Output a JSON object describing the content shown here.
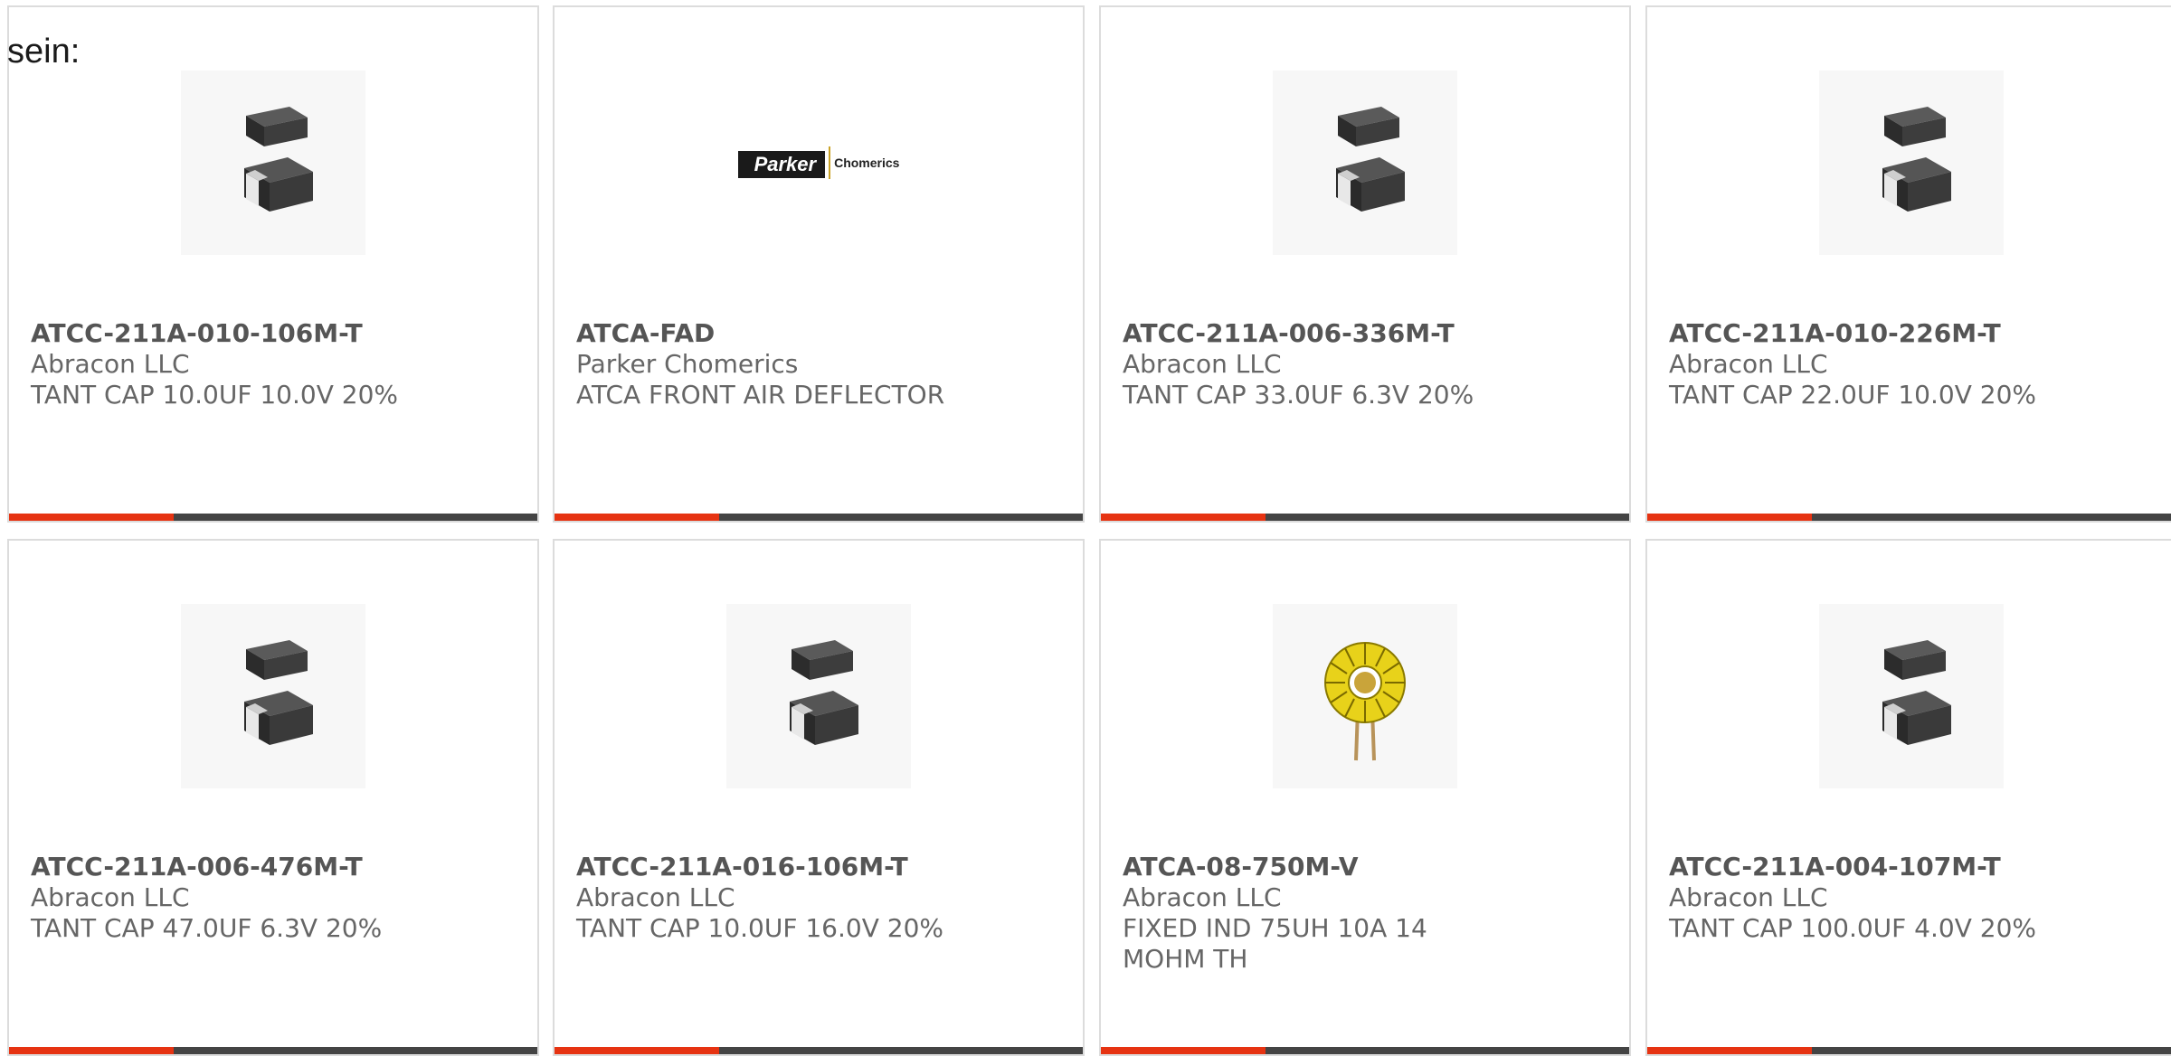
{
  "intro_text": "sein:",
  "accent_color": "#e63312",
  "products": [
    {
      "part": "ATCC-211A-010-106M-T",
      "manufacturer": "Abracon LLC",
      "description": "TANT CAP 10.0UF 10.0V 20%",
      "image": "tantalum-capacitor-icon"
    },
    {
      "part": "ATCA-FAD",
      "manufacturer": "Parker Chomerics",
      "description": "ATCA FRONT AIR DEFLECTOR",
      "image": "parker-chomerics-logo",
      "logo_word": "Parker",
      "logo_sub": "Chomerics"
    },
    {
      "part": "ATCC-211A-006-336M-T",
      "manufacturer": "Abracon LLC",
      "description": "TANT CAP 33.0UF 6.3V 20%",
      "image": "tantalum-capacitor-icon"
    },
    {
      "part": "ATCC-211A-010-226M-T",
      "manufacturer": "Abracon LLC",
      "description": "TANT CAP 22.0UF 10.0V 20%",
      "image": "tantalum-capacitor-icon"
    },
    {
      "part": "ATCC-211A-006-476M-T",
      "manufacturer": "Abracon LLC",
      "description": "TANT CAP 47.0UF 6.3V 20%",
      "image": "tantalum-capacitor-icon"
    },
    {
      "part": "ATCC-211A-016-106M-T",
      "manufacturer": "Abracon LLC",
      "description": "TANT CAP 10.0UF 16.0V 20%",
      "image": "tantalum-capacitor-icon"
    },
    {
      "part": "ATCA-08-750M-V",
      "manufacturer": "Abracon LLC",
      "description": "FIXED IND 75UH 10A 14 MOHM TH",
      "image": "toroid-inductor-icon"
    },
    {
      "part": "ATCC-211A-004-107M-T",
      "manufacturer": "Abracon LLC",
      "description": "TANT CAP 100.0UF 4.0V 20%",
      "image": "tantalum-capacitor-icon"
    }
  ]
}
